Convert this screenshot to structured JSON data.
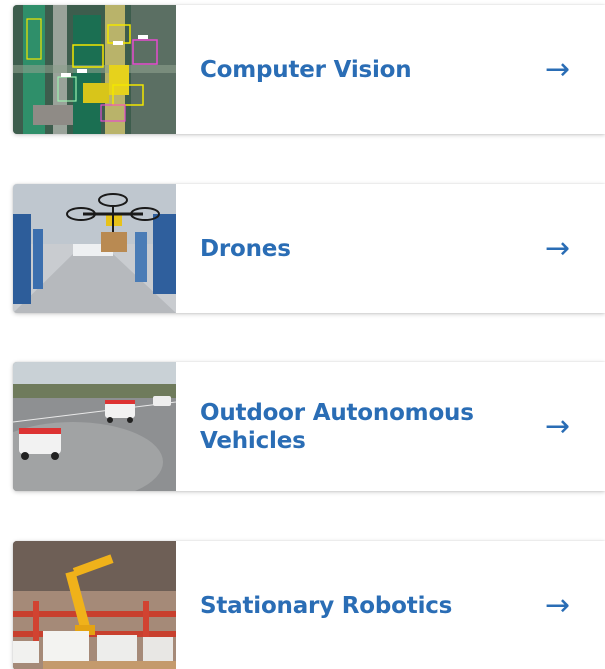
{
  "cards": [
    {
      "title": "Computer Vision",
      "image": "computer-vision-photo",
      "arrow_icon": "right-arrow-icon"
    },
    {
      "title": "Drones",
      "image": "drone-warehouse-photo",
      "arrow_icon": "right-arrow-icon"
    },
    {
      "title": "Outdoor Autonomous Vehicles",
      "image": "delivery-robots-photo",
      "arrow_icon": "right-arrow-icon"
    },
    {
      "title": "Stationary Robotics",
      "image": "robotic-arm-warehouse-photo",
      "arrow_icon": "right-arrow-icon"
    }
  ],
  "arrow_glyph": "→",
  "colors": {
    "accent": "#2a6db5",
    "card_bg": "#ffffff"
  }
}
